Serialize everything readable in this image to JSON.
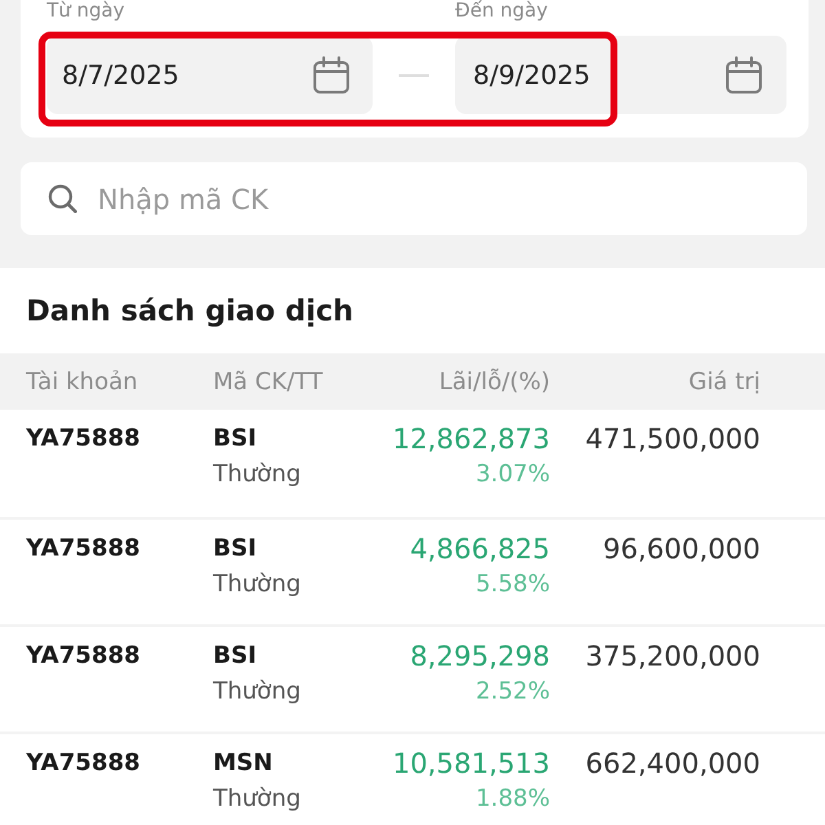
{
  "date_range": {
    "highlighted": true,
    "from": {
      "label": "Từ ngày",
      "value": "8/7/2025"
    },
    "to": {
      "label": "Đến ngày",
      "value": "8/9/2025"
    }
  },
  "search": {
    "placeholder": "Nhập mã CK"
  },
  "transactions": {
    "title": "Danh sách giao dịch",
    "columns": [
      "Tài khoản",
      "Mã CK/TT",
      "Lãi/lỗ/(%)",
      "Giá trị"
    ],
    "rows": [
      {
        "account": "YA75888",
        "symbol": "BSI",
        "order_type": "Thường",
        "profit": "12,862,873",
        "percent": "3.07%",
        "value": "471,500,000"
      },
      {
        "account": "YA75888",
        "symbol": "BSI",
        "order_type": "Thường",
        "profit": "4,866,825",
        "percent": "5.58%",
        "value": "96,600,000"
      },
      {
        "account": "YA75888",
        "symbol": "BSI",
        "order_type": "Thường",
        "profit": "8,295,298",
        "percent": "2.52%",
        "value": "375,200,000"
      },
      {
        "account": "YA75888",
        "symbol": "MSN",
        "order_type": "Thường",
        "profit": "10,581,513",
        "percent": "1.88%",
        "value": "662,400,000"
      }
    ]
  }
}
